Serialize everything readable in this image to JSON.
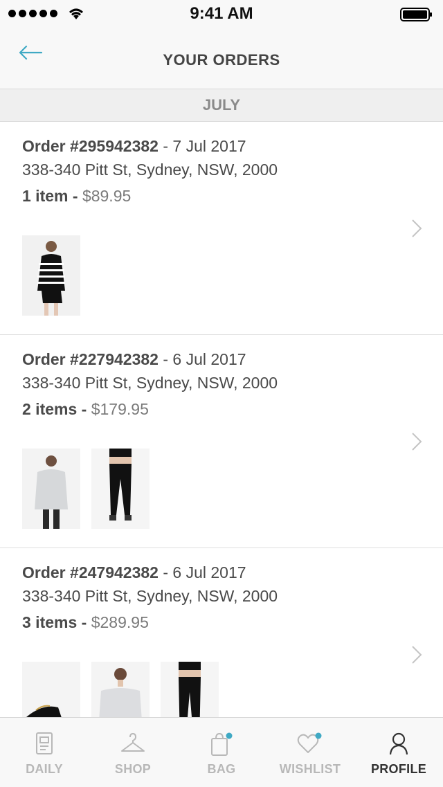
{
  "status_bar": {
    "time": "9:41 AM"
  },
  "nav": {
    "title": "YOUR ORDERS"
  },
  "section": {
    "label": "JULY"
  },
  "orders": [
    {
      "prefix": "Order #",
      "number": "295942382",
      "date": " - 7 Jul 2017",
      "address": "338-340 Pitt St, Sydney, NSW, 2000",
      "items": "1 item",
      "price": "$89.95"
    },
    {
      "prefix": "Order #",
      "number": "227942382",
      "date": " - 6 Jul 2017",
      "address": "338-340 Pitt St, Sydney, NSW, 2000",
      "items": "2 items",
      "price": "$179.95"
    },
    {
      "prefix": "Order #",
      "number": "247942382",
      "date": " - 6 Jul 2017",
      "address": "338-340 Pitt St, Sydney, NSW, 2000",
      "items": "3 items",
      "price": "$289.95"
    }
  ],
  "separator": " - ",
  "tabs": [
    {
      "label": "DAILY",
      "icon": "daily-icon"
    },
    {
      "label": "SHOP",
      "icon": "hanger-icon"
    },
    {
      "label": "BAG",
      "icon": "bag-icon"
    },
    {
      "label": "WISHLIST",
      "icon": "heart-icon"
    },
    {
      "label": "PROFILE",
      "icon": "profile-icon",
      "active": true
    }
  ],
  "colors": {
    "accent": "#3fa9c4",
    "notification_dot": "#3fa9c4"
  }
}
